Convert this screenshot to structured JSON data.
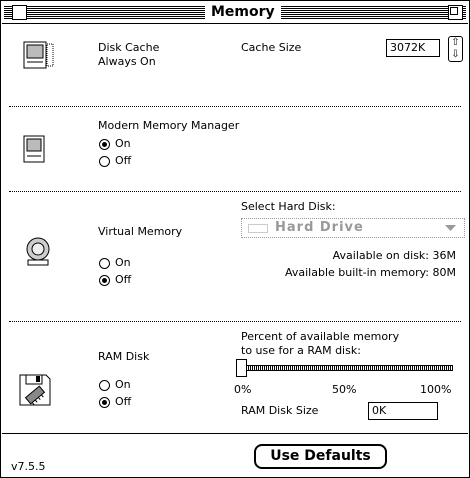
{
  "window": {
    "title": "Memory"
  },
  "disk_cache": {
    "label": "Disk Cache",
    "status": "Always On",
    "size_label": "Cache Size",
    "size_value": "3072K",
    "stepper_up": "⇧",
    "stepper_down": "⇩"
  },
  "modern_memory_manager": {
    "label": "Modern Memory Manager",
    "on_label": "On",
    "off_label": "Off",
    "selected": "On"
  },
  "virtual_memory": {
    "label": "Virtual Memory",
    "on_label": "On",
    "off_label": "Off",
    "selected": "Off",
    "select_disk_label": "Select Hard Disk:",
    "disk_name": "Hard Drive",
    "available_on_disk": "Available on disk: 36M",
    "available_builtin": "Available built-in memory: 80M"
  },
  "ram_disk": {
    "label": "RAM Disk",
    "on_label": "On",
    "off_label": "Off",
    "selected": "Off",
    "percent_label_line1": "Percent of available memory",
    "percent_label_line2": "to use for a RAM disk:",
    "slider_percent": 0,
    "tick_0": "0%",
    "tick_50": "50%",
    "tick_100": "100%",
    "size_label": "RAM Disk Size",
    "size_value": "0K"
  },
  "footer": {
    "version": "v7.5.5",
    "defaults_button": "Use Defaults"
  }
}
